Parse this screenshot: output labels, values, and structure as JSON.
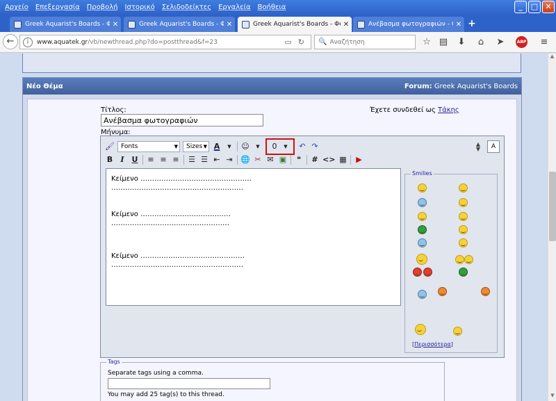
{
  "menu": [
    "Αρχείο",
    "Επεξεργασία",
    "Προβολή",
    "Ιστορικό",
    "Σελιδοδείκτες",
    "Εργαλεία",
    "Βοήθεια"
  ],
  "window_buttons": {
    "minimize": "_",
    "maximize": "□",
    "close": "✕"
  },
  "tabs": [
    {
      "label": "Greek Aquarist's Boards - Φό...",
      "close": "✕"
    },
    {
      "label": "Greek Aquarist's Boards - Φό...",
      "close": "✕"
    },
    {
      "label": "Greek Aquarist's Boards - Φό...",
      "close": "✕"
    },
    {
      "label": "Ανέβασμα φωτογραφιών - Gr...",
      "close": "✕"
    }
  ],
  "new_tab": "+",
  "nav": {
    "back": "←",
    "url_host": "www.aquatek.gr",
    "url_path": "/vb/newthread.php?do=postthread&f=23",
    "search_placeholder": "Αναζήτηση",
    "abp": "ABP"
  },
  "panel": {
    "title": "Νέο Θέμα",
    "forum_label": "Forum:",
    "forum_name": "Greek Aquarist's Boards"
  },
  "form": {
    "title_label": "Τίτλος:",
    "title_value": "Ανέβασμα φωτογραφιών",
    "logged_in_text": "Έχετε συνδεθεί ως",
    "username": "Τάκης",
    "message_label": "Μήνυμα:"
  },
  "toolbar": {
    "fonts": "Fonts",
    "sizes": "Sizes",
    "font_color": "A",
    "attach": "0",
    "bold": "B",
    "italic": "I",
    "underline": "U",
    "hash": "#",
    "code": "<>",
    "mode": "A"
  },
  "message_lines": [
    "Κείμενο …………………………………………",
    "…………………………………………………",
    "Κείμενο …………………………………",
    "……………………………………………",
    "Κείμενο ………………………………………",
    "…………………………………………………"
  ],
  "smilies": {
    "legend": "Smilies",
    "more_open": "[",
    "more_link": "Περισσότερα",
    "more_close": "]"
  },
  "tags": {
    "legend": "Tags",
    "hint": "Separate tags using a comma.",
    "value": "",
    "limit_text": "You may add 25 tag(s) to this thread."
  }
}
